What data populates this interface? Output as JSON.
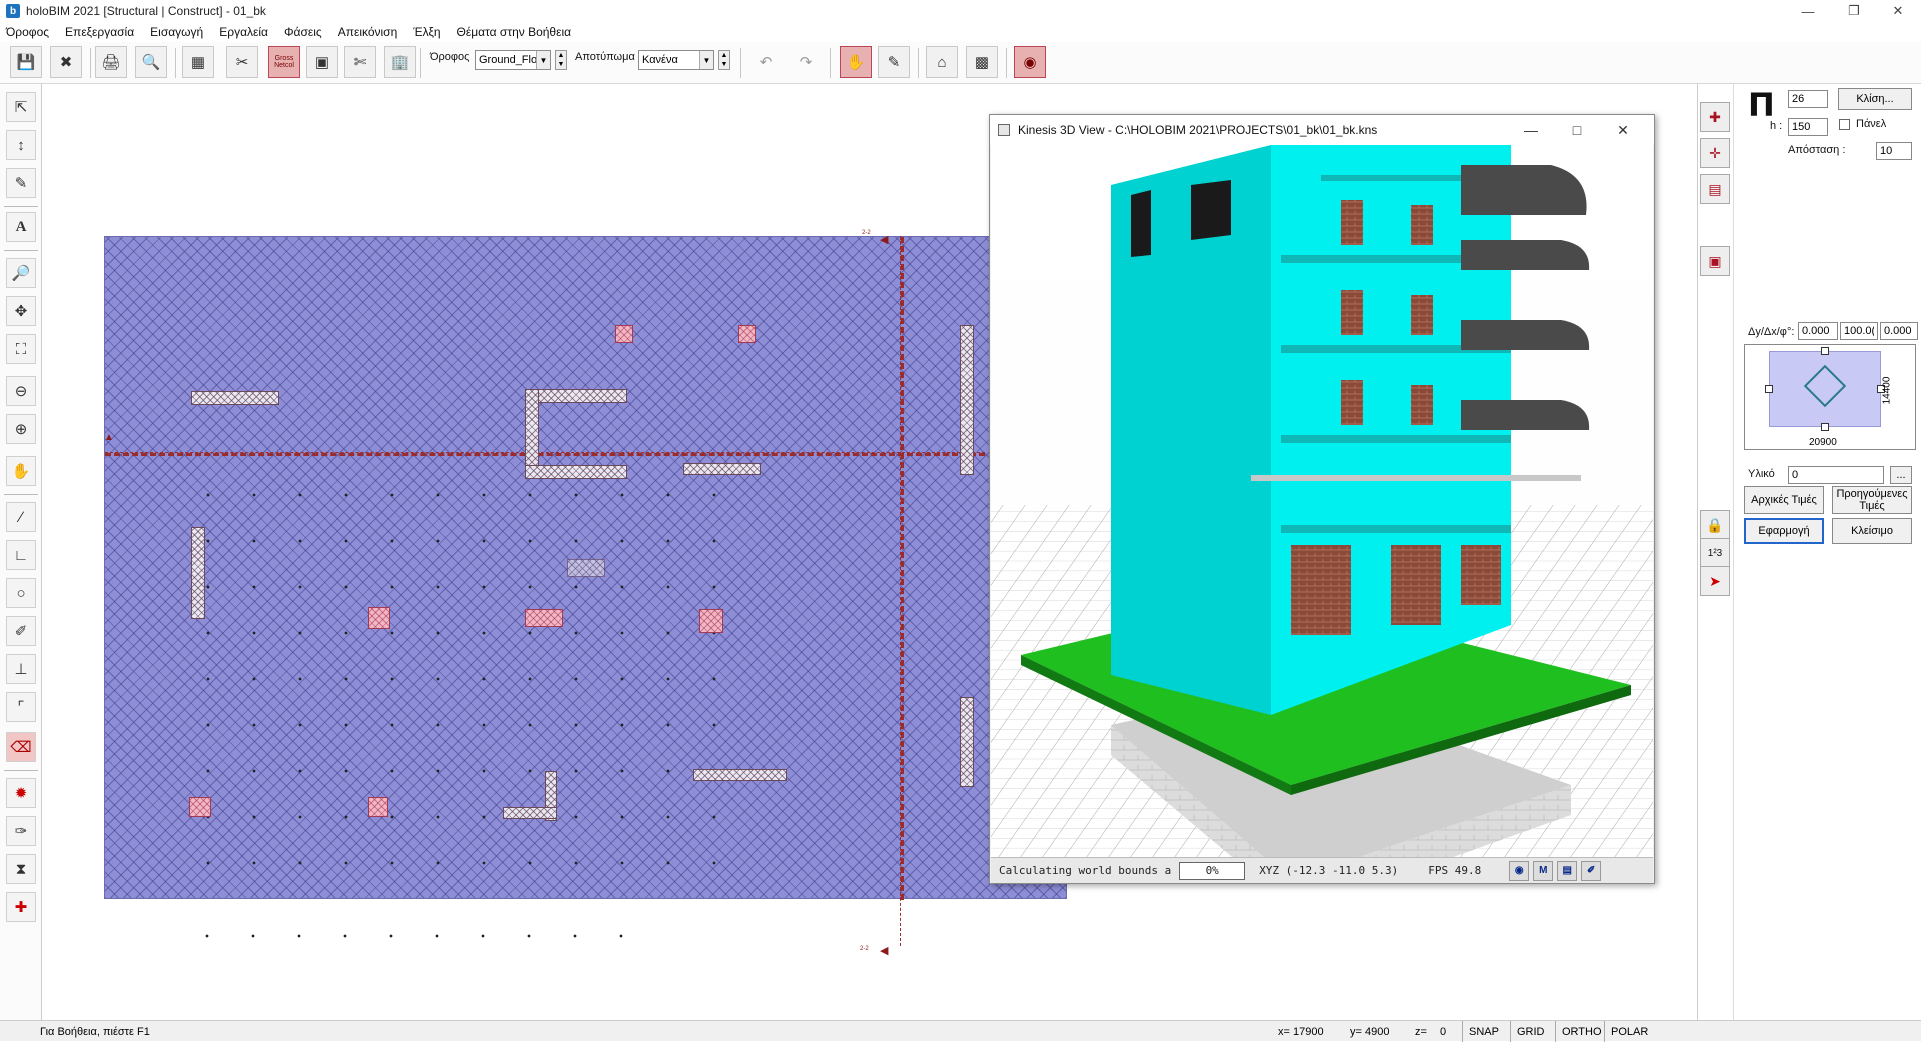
{
  "window": {
    "title": "holoBIM 2021 [Structural | Construct] - 01_bk",
    "app_icon": "b"
  },
  "menu": [
    "Όροφος",
    "Επεξεργασία",
    "Εισαγωγή",
    "Εργαλεία",
    "Φάσεις",
    "Απεικόνιση",
    "Έλξη",
    "Θέματα στην Βοήθεια"
  ],
  "toolbar": {
    "floor_label": "Όροφος",
    "floor_value": "Ground_Flo",
    "footprint_label": "Αποτύπωμα",
    "footprint_value": "Κανένα",
    "gross_label": "Gross Netcol"
  },
  "viewer": {
    "title": "Kinesis 3D View - C:\\HOLOBIM 2021\\PROJECTS\\01_bk\\01_bk.kns",
    "status_message": "Calculating world bounds a",
    "progress": "0%",
    "coords": "XYZ (-12.3 -11.0 5.3)",
    "fps": "FPS  49.8",
    "m_button": "M"
  },
  "section_marks": {
    "top": "2-2",
    "bottom": "2-2"
  },
  "props": {
    "shape_symbol": "Π",
    "width_value": "26",
    "slope_button": "Κλίση...",
    "h_label": "h :",
    "h_value": "150",
    "panel_label": "Πάνελ",
    "distance_label": "Απόσταση :",
    "distance_value": "10",
    "offset_label": "Δy/Δx/φ°:",
    "dy": "0.000",
    "dx": "100.0(",
    "phi": "0.000",
    "dim_vertical": "14400",
    "dim_horizontal": "20900",
    "material_label": "Υλικό",
    "material_value": "0",
    "material_browse": "...",
    "initial_values": "Αρχικές Τιμές",
    "previous_values": "Προηγούμενες Τιμές",
    "apply": "Εφαρμογή",
    "close": "Κλείσιμο",
    "numbering_label": "1²3"
  },
  "status": {
    "help": "Για Βοήθεια, πιέστε F1",
    "x": "x=  17900",
    "y": "y=  4900",
    "z": "z=",
    "z_value": "0",
    "snap": "SNAP",
    "grid": "GRID",
    "ortho": "ORTHO",
    "polar": "POLAR"
  },
  "colors": {
    "floor_fill": "#8e8ed6",
    "column_fill": "#f2b7c4",
    "building_cyan": "#00e5e5",
    "ground_green": "#1fbf1f"
  }
}
